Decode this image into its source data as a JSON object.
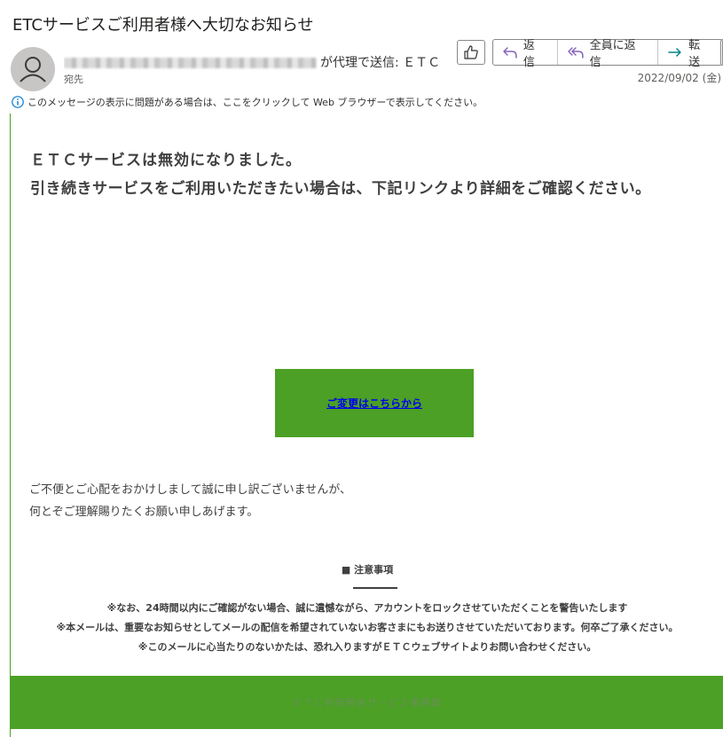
{
  "header": {
    "subject": "ETCサービスご利用者様へ大切なお知らせ",
    "on_behalf_text": "が代理で送信: ＥＴＣ",
    "to_label": "宛先",
    "date": "2022/09/02 (金)"
  },
  "actions": {
    "reply": "返信",
    "reply_all": "全員に返信",
    "forward": "転送"
  },
  "info_bar": {
    "text": "このメッセージの表示に問題がある場合は、ここをクリックして Web ブラウザーで表示してください。"
  },
  "message": {
    "headline1": "ＥＴＣサービスは無効になりました。",
    "headline2": "引き続きサービスをご利用いただきたい場合は、下記リンクより詳細をご確認ください。",
    "cta_link": "ご変更はこちらから",
    "apology_line1": "ご不便とご心配をおかけしまして誠に申し訳ございませんが、",
    "apology_line2": "何とぞご理解賜りたくお願い申しあげます。",
    "notice_title": "■ 注意事項",
    "notice_lines": [
      "※なお、24時間以内にご確認がない場合、誠に遺憾ながら、アカウントをロックさせていただくことを警告いたします",
      "※本メールは、重要なお知らせとしてメールの配信を希望されていないお客さまにもお送りさせていただいております。何卒ご了承ください。",
      "※このメールに心当たりのないかたは、恐れ入りますがＥＴＣウェブサイトよりお問い合わせください。"
    ],
    "footer": "ＥＴＣ利用照会サービス事務局"
  },
  "colors": {
    "brand_green": "#4ba025",
    "link_blue": "#0000ee",
    "reply_icon": "#8764b8",
    "forward_icon": "#038387",
    "info_icon": "#0078d4"
  },
  "icons": [
    "avatar-person-icon",
    "like-icon",
    "reply-icon",
    "reply-all-icon",
    "forward-icon",
    "info-icon"
  ]
}
